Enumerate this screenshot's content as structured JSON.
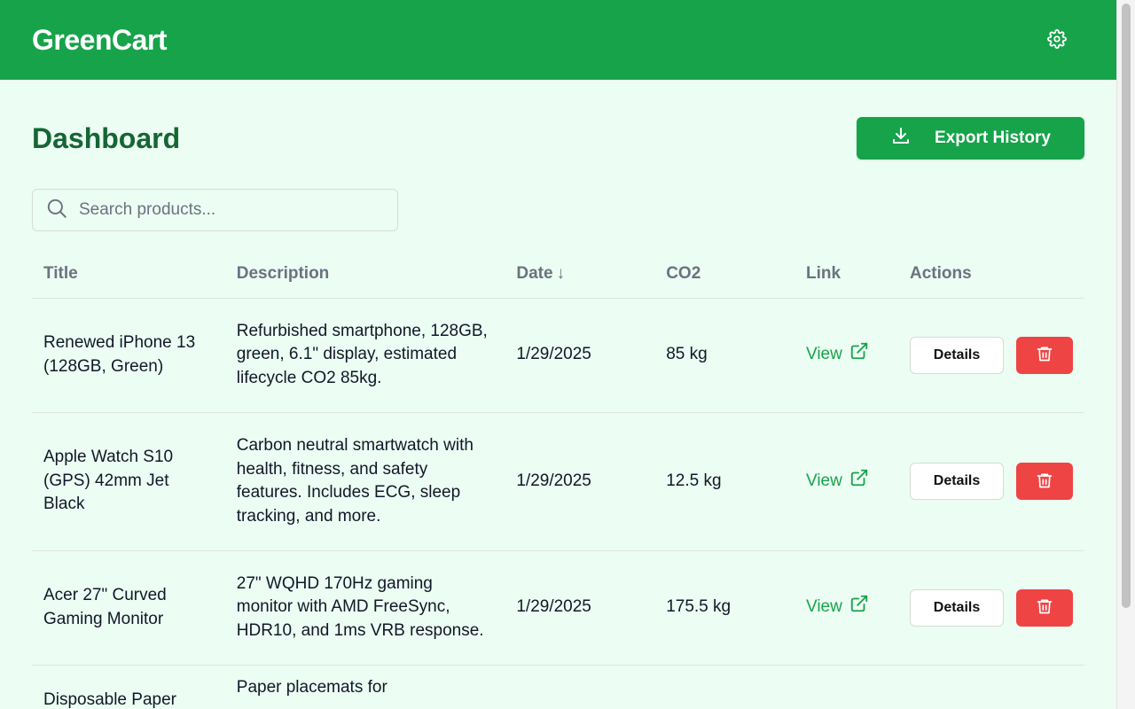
{
  "header": {
    "brand": "GreenCart",
    "settings_icon": "gear-icon"
  },
  "page": {
    "title": "Dashboard",
    "export_label": "Export History",
    "export_icon": "download-icon"
  },
  "search": {
    "placeholder": "Search products...",
    "value": "",
    "icon": "search-icon"
  },
  "table": {
    "columns": [
      "Title",
      "Description",
      "Date",
      "CO2",
      "Link",
      "Actions"
    ],
    "sort_indicator": "↓",
    "rows": [
      {
        "title": "Renewed iPhone 13 (128GB, Green)",
        "description": "Refurbished smartphone, 128GB, green, 6.1\" display, estimated lifecycle CO2 85kg.",
        "date": "1/29/2025",
        "co2": "85 kg",
        "link": "View",
        "details": "Details"
      },
      {
        "title": "Apple Watch S10 (GPS) 42mm Jet Black",
        "description": "Carbon neutral smartwatch with health, fitness, and safety features. Includes ECG, sleep tracking, and more.",
        "date": "1/29/2025",
        "co2": "12.5 kg",
        "link": "View",
        "details": "Details"
      },
      {
        "title": "Acer 27\" Curved Gaming Monitor",
        "description": "27\" WQHD 170Hz gaming monitor with AMD FreeSync, HDR10, and 1ms VRB response.",
        "date": "1/29/2025",
        "co2": "175.5 kg",
        "link": "View",
        "details": "Details"
      },
      {
        "title": "Disposable Paper",
        "description": "Paper placemats for",
        "date": "",
        "co2": "",
        "link": "",
        "details": ""
      }
    ]
  },
  "colors": {
    "brand_green": "#16a34a",
    "title_green": "#166534",
    "background": "#ecfdf3",
    "delete_red": "#ef4444"
  }
}
